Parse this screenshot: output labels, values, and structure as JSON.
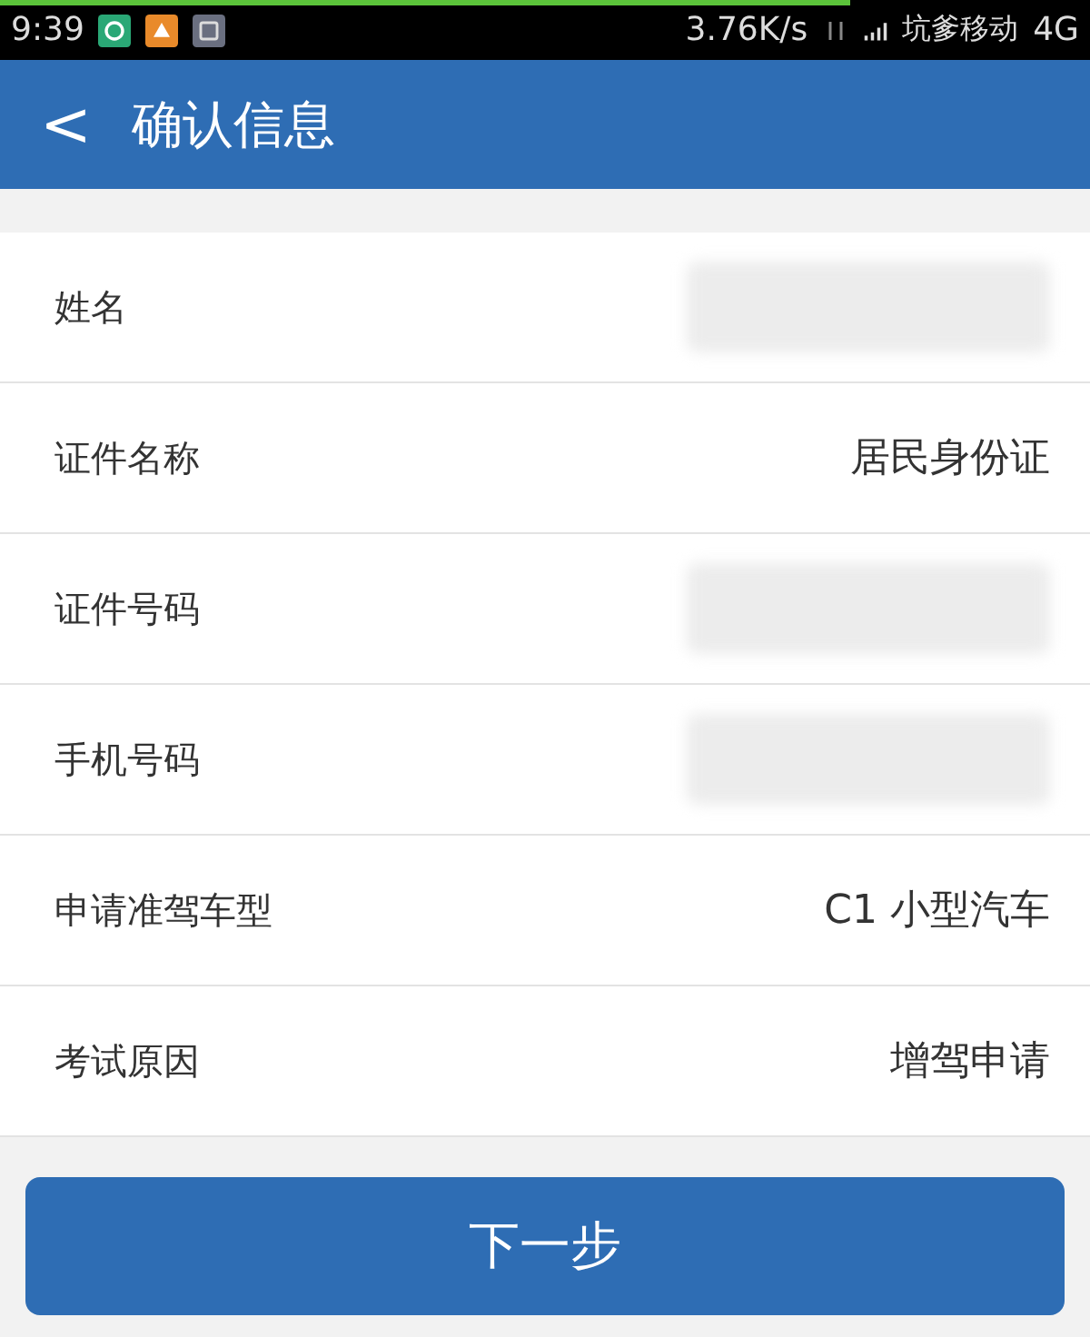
{
  "status_bar": {
    "time": "9:39",
    "speed": "3.76K/s",
    "carrier": "坑爹移动",
    "network": "4G"
  },
  "load_progress": {
    "level": 0.78
  },
  "header": {
    "back": "<",
    "title": "确认信息"
  },
  "rows": [
    {
      "label": "姓名",
      "redacted": true
    },
    {
      "label": "证件名称",
      "value": "居民身份证",
      "redacted": false
    },
    {
      "label": "证件号码",
      "redacted": true
    },
    {
      "label": "手机号码",
      "redacted": true
    },
    {
      "label": "申请准驾车型",
      "value": "C1  小型汽车",
      "redacted": false
    },
    {
      "label": "考试原因",
      "value": "增驾申请",
      "redacted": false
    }
  ],
  "next_button": "下一步"
}
